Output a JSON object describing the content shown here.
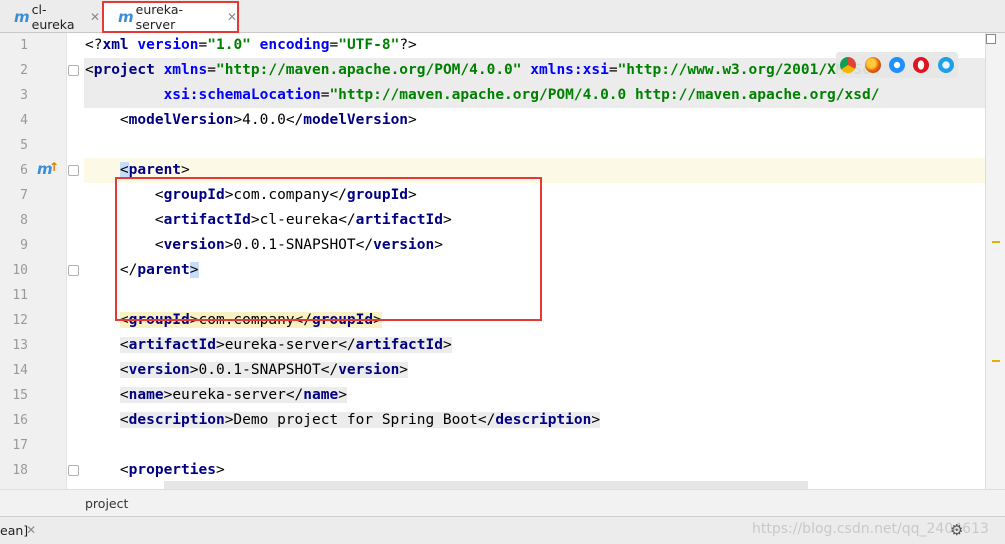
{
  "tabs": [
    {
      "label": "cl-eureka",
      "active": false
    },
    {
      "label": "eureka-server",
      "active": true
    }
  ],
  "lines": [
    {
      "n": "1",
      "text": "<?xml version=\"1.0\" encoding=\"UTF-8\"?>"
    },
    {
      "n": "2",
      "text": "<project xmlns=\"http://maven.apache.org/POM/4.0.0\" xmlns:xsi=\"http://www.w3.org/2001/XMLSch"
    },
    {
      "n": "3",
      "text": "         xsi:schemaLocation=\"http://maven.apache.org/POM/4.0.0 http://maven.apache.org/xsd/"
    },
    {
      "n": "4",
      "text": "    <modelVersion>4.0.0</modelVersion>"
    },
    {
      "n": "5",
      "text": ""
    },
    {
      "n": "6",
      "text": "    <parent>"
    },
    {
      "n": "7",
      "text": "        <groupId>com.company</groupId>"
    },
    {
      "n": "8",
      "text": "        <artifactId>cl-eureka</artifactId>"
    },
    {
      "n": "9",
      "text": "        <version>0.0.1-SNAPSHOT</version>"
    },
    {
      "n": "10",
      "text": "    </parent>"
    },
    {
      "n": "11",
      "text": ""
    },
    {
      "n": "12",
      "text": "    <groupId>com.company</groupId>"
    },
    {
      "n": "13",
      "text": "    <artifactId>eureka-server</artifactId>"
    },
    {
      "n": "14",
      "text": "    <version>0.0.1-SNAPSHOT</version>"
    },
    {
      "n": "15",
      "text": "    <name>eureka-server</name>"
    },
    {
      "n": "16",
      "text": "    <description>Demo project for Spring Boot</description>"
    },
    {
      "n": "17",
      "text": ""
    },
    {
      "n": "18",
      "text": "    <properties>"
    }
  ],
  "breadcrumb": "project",
  "status": {
    "tab_label": "ean]",
    "watermark": "https://blog.csdn.net/qq_2404613"
  },
  "colors": {
    "tag": "#000080",
    "attr": "#0000ff",
    "value": "#008000",
    "highlight_box": "#e53935",
    "maven_icon": "#3c8fd6"
  },
  "icons": [
    "maven-icon",
    "close-icon",
    "chrome-icon",
    "firefox-icon",
    "safari-icon",
    "opera-icon",
    "ie-icon",
    "gear-icon"
  ]
}
